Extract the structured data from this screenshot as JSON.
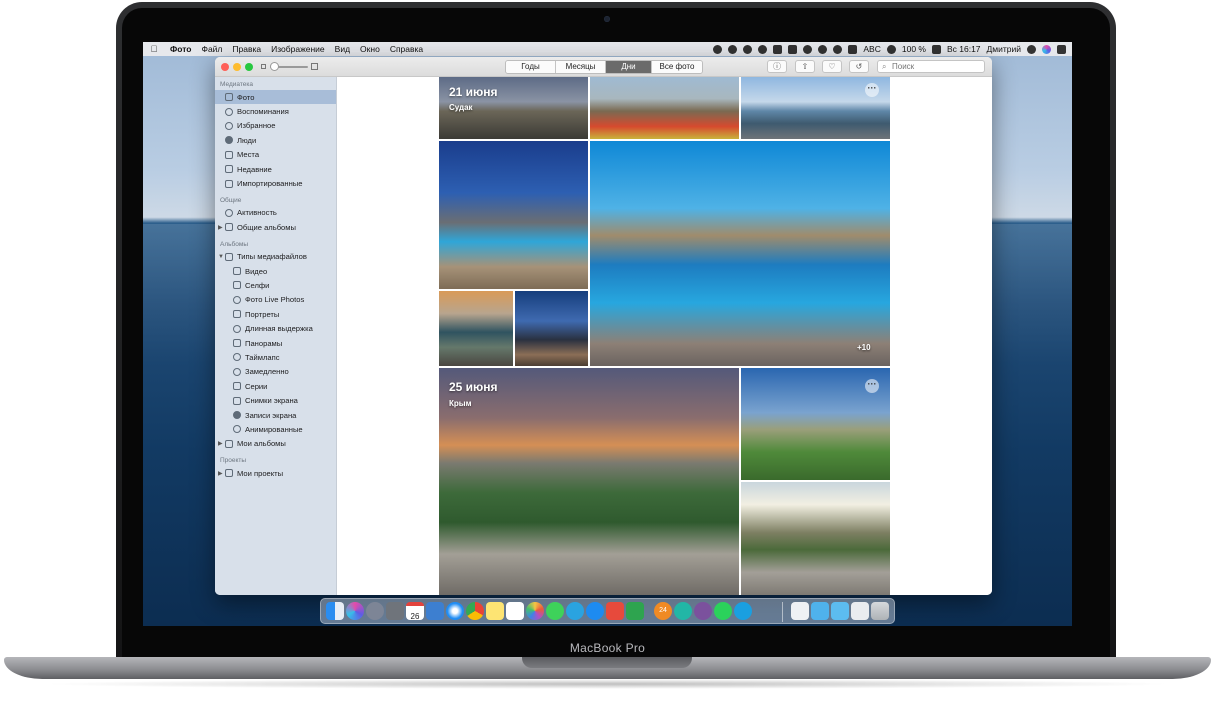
{
  "device": {
    "label": "MacBook Pro"
  },
  "menubar": {
    "app_name": "Фото",
    "items": [
      "Файл",
      "Правка",
      "Изображение",
      "Вид",
      "Окно",
      "Справка"
    ],
    "input_source": "ABC",
    "battery": "100 %",
    "clock": "Вс 16:17",
    "user": "Дмитрий"
  },
  "toolbar": {
    "segments": [
      "Годы",
      "Месяцы",
      "Дни",
      "Все фото"
    ],
    "active_segment": "Дни",
    "search_placeholder": "Поиск"
  },
  "sidebar": {
    "sections": [
      {
        "title": "Медиатека",
        "items": [
          {
            "label": "Фото",
            "icon": "photos-icon",
            "active": true
          },
          {
            "label": "Воспоминания",
            "icon": "memories-icon"
          },
          {
            "label": "Избранное",
            "icon": "heart-icon"
          },
          {
            "label": "Люди",
            "icon": "person-icon"
          },
          {
            "label": "Места",
            "icon": "pin-icon"
          },
          {
            "label": "Недавние",
            "icon": "clock-icon"
          },
          {
            "label": "Импортированные",
            "icon": "import-icon"
          }
        ]
      },
      {
        "title": "Общие",
        "items": [
          {
            "label": "Активность",
            "icon": "cloud-icon"
          },
          {
            "label": "Общие альбомы",
            "icon": "folder-icon"
          }
        ]
      },
      {
        "title": "Альбомы",
        "items": [
          {
            "label": "Типы медиафайлов",
            "icon": "folder-icon"
          },
          {
            "label": "Видео",
            "icon": "video-icon"
          },
          {
            "label": "Селфи",
            "icon": "selfie-icon"
          },
          {
            "label": "Фото Live Photos",
            "icon": "live-photo-icon"
          },
          {
            "label": "Портреты",
            "icon": "portrait-icon"
          },
          {
            "label": "Длинная выдержка",
            "icon": "long-exposure-icon"
          },
          {
            "label": "Панорамы",
            "icon": "panorama-icon"
          },
          {
            "label": "Таймлапс",
            "icon": "timelapse-icon"
          },
          {
            "label": "Замедленно",
            "icon": "slomo-icon"
          },
          {
            "label": "Серии",
            "icon": "burst-icon"
          },
          {
            "label": "Снимки экрана",
            "icon": "screenshot-icon"
          },
          {
            "label": "Записи экрана",
            "icon": "screen-record-icon"
          },
          {
            "label": "Анимированные",
            "icon": "animated-icon"
          },
          {
            "label": "Мои альбомы",
            "icon": "folder-icon"
          }
        ]
      },
      {
        "title": "Проекты",
        "items": [
          {
            "label": "Мои проекты",
            "icon": "folder-icon"
          }
        ]
      }
    ]
  },
  "groups": [
    {
      "date": "21 июня",
      "place": "Судак",
      "more_count": "+10"
    },
    {
      "date": "25 июня",
      "place": "Крым"
    }
  ],
  "dock": {
    "calendar_day": "26",
    "badge": "24"
  }
}
